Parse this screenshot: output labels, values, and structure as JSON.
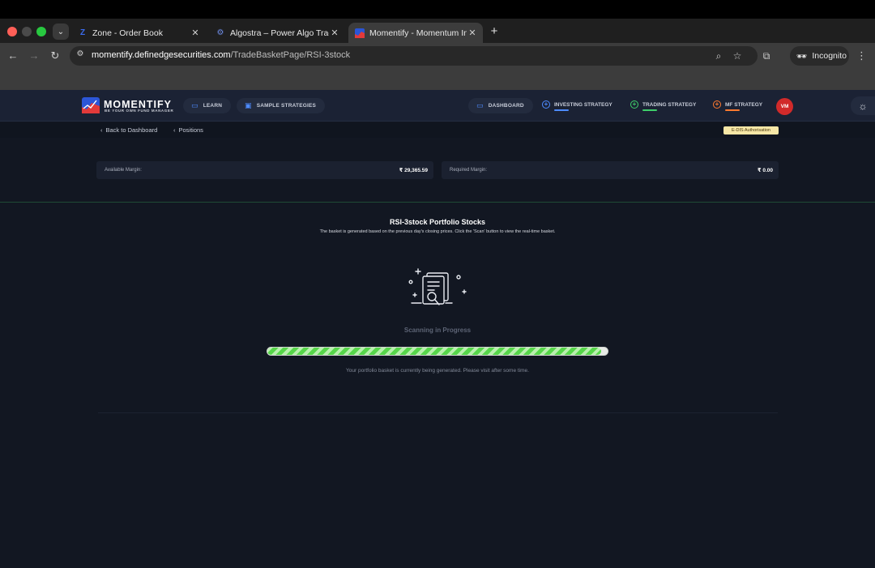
{
  "browser": {
    "tabs": [
      {
        "title": "Zone - Order Book",
        "favicon": "zone-z-icon",
        "active": false
      },
      {
        "title": "Algostra – Power Algo Trading",
        "favicon": "gear-favicon-icon",
        "active": false
      },
      {
        "title": "Momentify - Momentum Inves",
        "favicon": "momentify-favicon-icon",
        "active": true
      }
    ],
    "url_host": "momentify.definedgesecurities.com",
    "url_path": "/TradeBasketPage/RSI-3stock",
    "incognito_label": "Incognito"
  },
  "app": {
    "logo_title": "MOMENTIFY",
    "logo_subtitle": "BE YOUR OWN FUND MANAGER",
    "nav_left": [
      {
        "label": "LEARN",
        "icon": "book-icon"
      },
      {
        "label": "SAMPLE STRATEGIES",
        "icon": "strategy-icon"
      }
    ],
    "dashboard_label": "DASHBOARD",
    "investing_label": "INVESTING STRATEGY",
    "trading_label": "TRADING STRATEGY",
    "mf_label": "MF STRATEGY",
    "avatar_initials": "VM",
    "colors": {
      "accent_blue": "#4d8bff",
      "accent_green": "#3ecf6a",
      "accent_orange": "#ff7a2f",
      "avatar_red": "#d12a2a"
    }
  },
  "subnav": {
    "back_label": "Back to Dashboard",
    "positions_label": "Positions",
    "edis_label": "E-DIS Authorisation"
  },
  "margins": {
    "available_label": "Available Margin:",
    "available_value": "₹ 29,365.59",
    "required_label": "Required Margin:",
    "required_value": "₹ 0.00"
  },
  "main": {
    "title": "RSI-3stock Portfolio Stocks",
    "subtitle": "The basket is generated based on the previous day's closing prices. Click the 'Scan' button to view the real-time basket.",
    "scan_status": "Scanning in Progress",
    "progress_fraction": 0.98,
    "info": "Your portfolio basket is currently being generated. Please visit after some time."
  }
}
